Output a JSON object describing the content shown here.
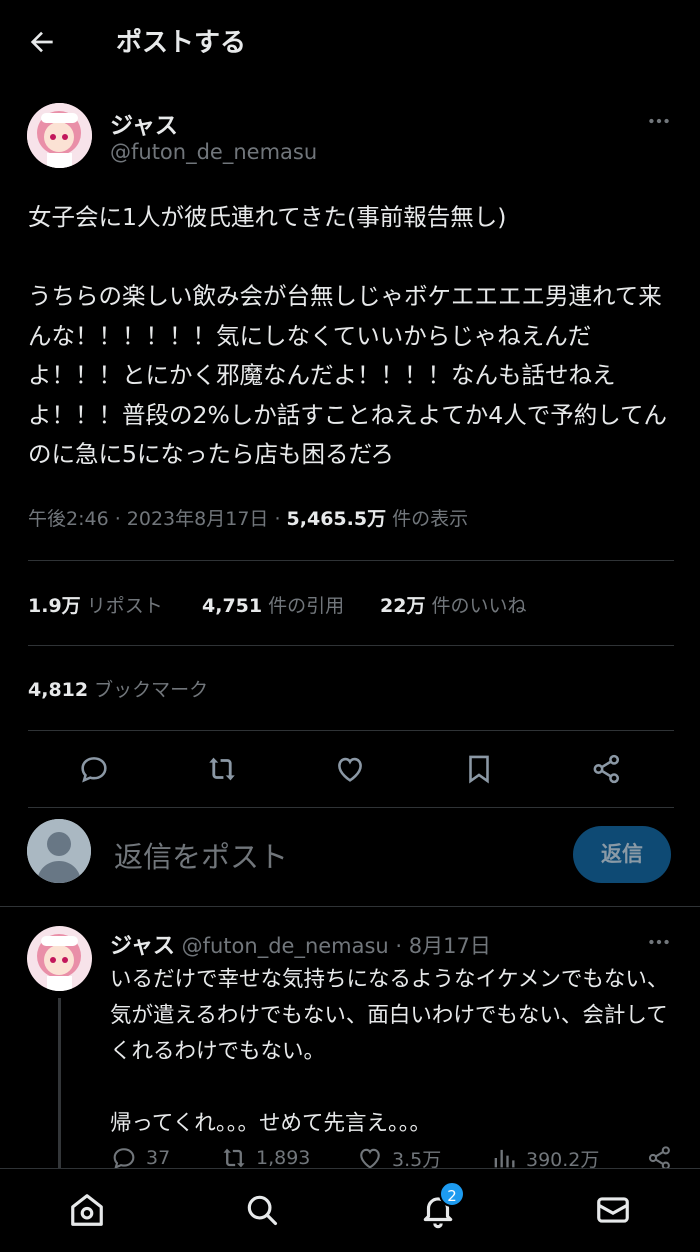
{
  "header": {
    "title": "ポストする"
  },
  "tweet": {
    "author_name": "ジャス",
    "author_handle": "@futon_de_nemasu",
    "text": "女子会に1人が彼氏連れてきた(事前報告無し)\n\nうちらの楽しい飲み会が台無しじゃボケエエエエ男連れて来んな！！！！！！気にしなくていいからじゃねえんだよ！！！とにかく邪魔なんだよ！！！！なんも話せねえよ！！！普段の2%しか話すことねえよてか4人で予約してんのに急に5になったら店も困るだろ",
    "time": "午後2:46 · 2023年8月17日 · ",
    "views_value": "5,465.5万",
    "views_label": " 件の表示"
  },
  "stats": {
    "reposts_value": "1.9万",
    "reposts_label": " リポスト",
    "quotes_value": "4,751",
    "quotes_label": " 件の引用",
    "likes_value": "22万",
    "likes_label": " 件のいいね",
    "bookmarks_value": "4,812",
    "bookmarks_label": " ブックマーク"
  },
  "reply_bar": {
    "placeholder": "返信をポスト",
    "button": "返信"
  },
  "reply": {
    "author_name": "ジャス",
    "author_handle": "@futon_de_nemasu",
    "date": " · 8月17日",
    "text": "いるだけで幸せな気持ちになるようなイケメンでもない、気が遣えるわけでもない、面白いわけでもない、会計してくれるわけでもない。\n\n帰ってくれ。。。せめて先言え。。。",
    "replies": "37",
    "reposts": "1,893",
    "likes": "3.5万",
    "views": "390.2万"
  },
  "nav": {
    "notifications_badge": "2"
  },
  "colors": {
    "background": "#000000",
    "text": "#e7e9ea",
    "muted": "#71767b",
    "accent": "#1d9bf0",
    "divider": "#2f3336"
  }
}
